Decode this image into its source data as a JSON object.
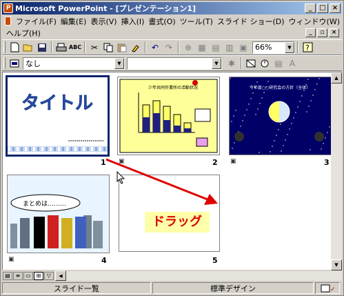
{
  "window": {
    "title": "Microsoft PowerPoint - [プレゼンテーション1]",
    "app_icon": "P",
    "minimize": "_",
    "maximize": "□",
    "close": "×"
  },
  "menu": {
    "items_row1": [
      "ファイル(F)",
      "編集(E)",
      "表示(V)",
      "挿入(I)",
      "書式(O)",
      "ツール(T)",
      "スライド ショー(D)",
      "ウィンドウ(W)"
    ],
    "items_row2": [
      "ヘルプ(H)"
    ],
    "doc_min": "_",
    "doc_restore": "▫",
    "doc_close": "×"
  },
  "toolbar": {
    "zoom": "66%",
    "icons": [
      "new-icon",
      "open-icon",
      "save-icon",
      "print-icon",
      "spellcheck-icon",
      "cut-icon",
      "copy-icon",
      "paste-icon",
      "format-painter-icon",
      "undo-icon",
      "redo-icon",
      "hyperlink-icon",
      "tables-icon",
      "insert-table-icon",
      "chart-icon",
      "new-slide-icon",
      "help-icon"
    ]
  },
  "sorter_toolbar": {
    "transition": "なし",
    "effect": ""
  },
  "slides": [
    {
      "number": "1",
      "title": "タイトル",
      "subtitle_line": "2000年 〇〇 〇 〇"
    },
    {
      "number": "2",
      "chart_title": "少年共同作業所の活動状況"
    },
    {
      "number": "3",
      "chart_title": "今年度○○研究会の方針（全体）"
    },
    {
      "number": "4",
      "speech": "まとめは………"
    },
    {
      "number": "5",
      "drag_label": "ドラッグ"
    }
  ],
  "status": {
    "view": "スライド一覧",
    "design": "標準デザイン"
  },
  "colors": {
    "titlebar": "#0a246a",
    "drag_arrow": "#e00000",
    "slide2_bg": "#ffff99",
    "slide3_bg": "#000066",
    "drag_box": "#ffffaa"
  }
}
